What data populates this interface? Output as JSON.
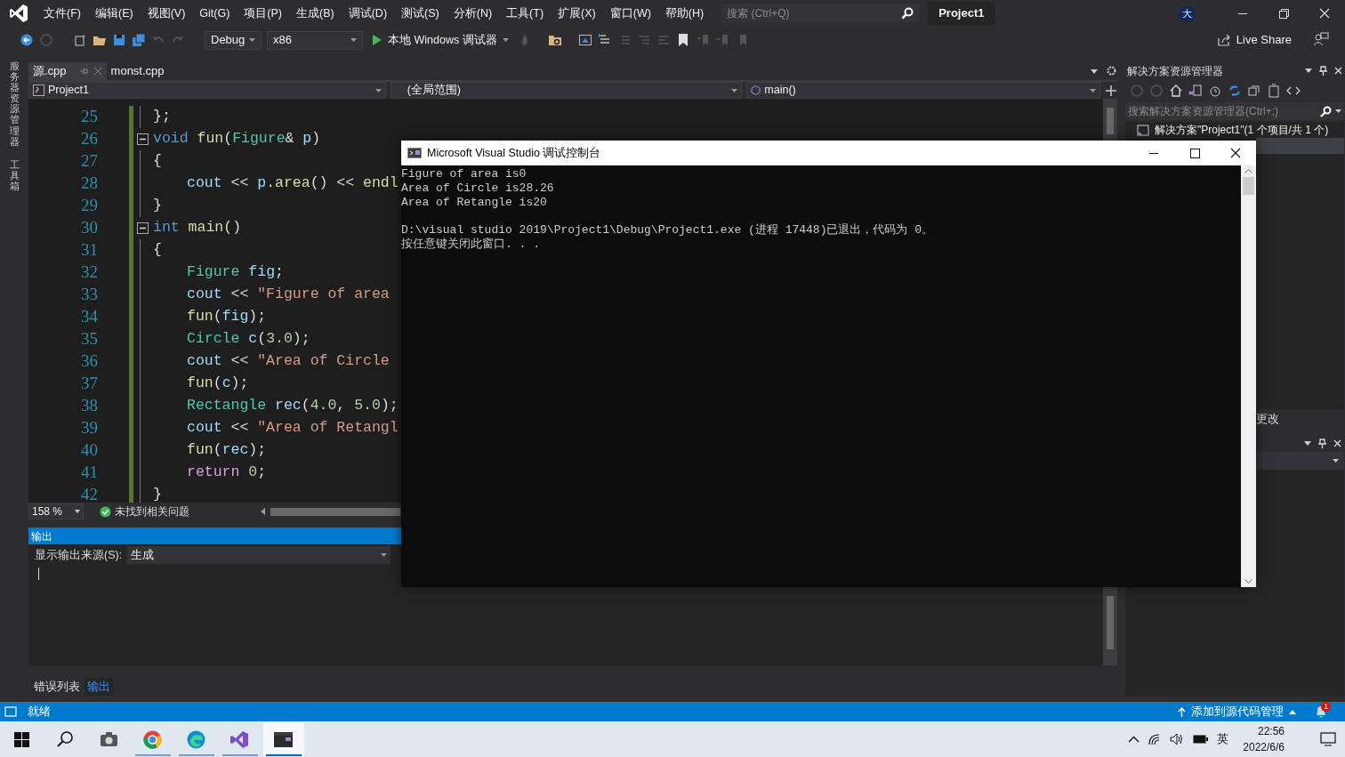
{
  "title_bar": {
    "menus": [
      "文件(F)",
      "编辑(E)",
      "视图(V)",
      "Git(G)",
      "项目(P)",
      "生成(B)",
      "调试(D)",
      "测试(S)",
      "分析(N)",
      "工具(T)",
      "扩展(X)",
      "窗口(W)",
      "帮助(H)"
    ],
    "search": {
      "placeholder": "搜索 (Ctrl+Q)"
    },
    "solution_name": "Project1",
    "account_initial": "大"
  },
  "toolbar": {
    "configuration": "Debug",
    "platform": "x86",
    "run_label": "本地 Windows 调试器",
    "live_share": "Live Share"
  },
  "side_tabs": [
    "服务器资源管理器",
    "工具箱"
  ],
  "document_tabs": [
    {
      "label": "源.cpp",
      "selected": true
    },
    {
      "label": "monst.cpp",
      "selected": false
    }
  ],
  "nav_bar": {
    "project": "Project1",
    "scope": "(全局范围)",
    "member": "main()"
  },
  "editor": {
    "lines": [
      {
        "number": "25",
        "foldable": false,
        "indented": false,
        "tokens": [
          {
            "kind": "plain",
            "text": "};"
          }
        ]
      },
      {
        "number": "26",
        "foldable": true,
        "indented": false,
        "tokens": [
          {
            "kind": "keyword",
            "text": "void"
          },
          {
            "kind": "func",
            "text": " fun"
          },
          {
            "kind": "plain",
            "text": "("
          },
          {
            "kind": "type",
            "text": "Figure"
          },
          {
            "kind": "plain",
            "text": "& "
          },
          {
            "kind": "param",
            "text": "p"
          },
          {
            "kind": "plain",
            "text": ")"
          }
        ]
      },
      {
        "number": "27",
        "foldable": false,
        "indented": false,
        "tokens": [
          {
            "kind": "plain",
            "text": "{"
          }
        ]
      },
      {
        "number": "28",
        "foldable": false,
        "indented": true,
        "tokens": [
          {
            "kind": "var",
            "text": "cout"
          },
          {
            "kind": "plain",
            "text": " << "
          },
          {
            "kind": "param",
            "text": "p"
          },
          {
            "kind": "plain",
            "text": "."
          },
          {
            "kind": "func",
            "text": "area"
          },
          {
            "kind": "plain",
            "text": "() << "
          },
          {
            "kind": "func",
            "text": "endl"
          }
        ]
      },
      {
        "number": "29",
        "foldable": false,
        "indented": false,
        "tokens": [
          {
            "kind": "plain",
            "text": "}"
          }
        ]
      },
      {
        "number": "30",
        "foldable": true,
        "indented": false,
        "tokens": [
          {
            "kind": "keyword",
            "text": "int"
          },
          {
            "kind": "func",
            "text": " main"
          },
          {
            "kind": "plain",
            "text": "()"
          }
        ]
      },
      {
        "number": "31",
        "foldable": false,
        "indented": false,
        "tokens": [
          {
            "kind": "plain",
            "text": "{"
          }
        ]
      },
      {
        "number": "32",
        "foldable": false,
        "indented": true,
        "tokens": [
          {
            "kind": "type",
            "text": "Figure"
          },
          {
            "kind": "var",
            "text": " fig"
          },
          {
            "kind": "plain",
            "text": ";"
          }
        ]
      },
      {
        "number": "33",
        "foldable": false,
        "indented": true,
        "tokens": [
          {
            "kind": "var",
            "text": "cout"
          },
          {
            "kind": "plain",
            "text": " << "
          },
          {
            "kind": "string",
            "text": "\"Figure of area"
          }
        ]
      },
      {
        "number": "34",
        "foldable": false,
        "indented": true,
        "tokens": [
          {
            "kind": "func",
            "text": "fun"
          },
          {
            "kind": "plain",
            "text": "("
          },
          {
            "kind": "var",
            "text": "fig"
          },
          {
            "kind": "plain",
            "text": ");"
          }
        ]
      },
      {
        "number": "35",
        "foldable": false,
        "indented": true,
        "tokens": [
          {
            "kind": "type",
            "text": "Circle"
          },
          {
            "kind": "var",
            "text": " c"
          },
          {
            "kind": "plain",
            "text": "("
          },
          {
            "kind": "number",
            "text": "3.0"
          },
          {
            "kind": "plain",
            "text": ");"
          }
        ]
      },
      {
        "number": "36",
        "foldable": false,
        "indented": true,
        "tokens": [
          {
            "kind": "var",
            "text": "cout"
          },
          {
            "kind": "plain",
            "text": " << "
          },
          {
            "kind": "string",
            "text": "\"Area of Circle"
          }
        ]
      },
      {
        "number": "37",
        "foldable": false,
        "indented": true,
        "tokens": [
          {
            "kind": "func",
            "text": "fun"
          },
          {
            "kind": "plain",
            "text": "("
          },
          {
            "kind": "var",
            "text": "c"
          },
          {
            "kind": "plain",
            "text": ");"
          }
        ]
      },
      {
        "number": "38",
        "foldable": false,
        "indented": true,
        "tokens": [
          {
            "kind": "type",
            "text": "Rectangle"
          },
          {
            "kind": "var",
            "text": " rec"
          },
          {
            "kind": "plain",
            "text": "("
          },
          {
            "kind": "number",
            "text": "4.0"
          },
          {
            "kind": "plain",
            "text": ", "
          },
          {
            "kind": "number",
            "text": "5.0"
          },
          {
            "kind": "plain",
            "text": ");"
          }
        ]
      },
      {
        "number": "39",
        "foldable": false,
        "indented": true,
        "tokens": [
          {
            "kind": "var",
            "text": "cout"
          },
          {
            "kind": "plain",
            "text": " << "
          },
          {
            "kind": "string",
            "text": "\"Area of Retangl"
          }
        ]
      },
      {
        "number": "40",
        "foldable": false,
        "indented": true,
        "tokens": [
          {
            "kind": "func",
            "text": "fun"
          },
          {
            "kind": "plain",
            "text": "("
          },
          {
            "kind": "var",
            "text": "rec"
          },
          {
            "kind": "plain",
            "text": ");"
          }
        ]
      },
      {
        "number": "41",
        "foldable": false,
        "indented": true,
        "tokens": [
          {
            "kind": "control",
            "text": "return"
          },
          {
            "kind": "number",
            "text": " 0"
          },
          {
            "kind": "plain",
            "text": ";"
          }
        ]
      },
      {
        "number": "42",
        "foldable": false,
        "indented": false,
        "tokens": [
          {
            "kind": "plain",
            "text": "}"
          }
        ]
      }
    ],
    "zoom": "158 %",
    "issues": "未找到相关问题"
  },
  "output_panel": {
    "title": "输出",
    "source_label": "显示输出来源(S):",
    "source_value": "生成"
  },
  "bottom_tabs": [
    {
      "label": "错误列表",
      "selected": false
    },
    {
      "label": "输出",
      "selected": true
    }
  ],
  "solution_explorer": {
    "title": "解决方案资源管理器",
    "search": {
      "placeholder": "搜索解决方案资源管理器(Ctrl+;)"
    },
    "root": "解决方案\"Project1\"(1 个项目/共 1 个)",
    "partial_tab": "更改"
  },
  "console": {
    "title": "Microsoft Visual Studio 调试控制台",
    "blocks": [
      [
        "Figure of area is0",
        "Area of Circle is28.26",
        "Area of Retangle is20"
      ],
      [
        "D:\\visual studio 2019\\Project1\\Debug\\Project1.exe (进程 17448)已退出，代码为 0。",
        "按任意键关闭此窗口. . ."
      ]
    ]
  },
  "status_bar": {
    "state": "就绪",
    "source_control": "添加到源代码管理",
    "notifications": "1"
  },
  "taskbar": {
    "apps": [
      {
        "kind": "start",
        "running": false,
        "selected": false
      },
      {
        "kind": "search",
        "running": false,
        "selected": false
      },
      {
        "kind": "camera",
        "running": false,
        "selected": false
      },
      {
        "kind": "browser",
        "running": true,
        "selected": false
      },
      {
        "kind": "edge",
        "running": true,
        "selected": false
      },
      {
        "kind": "studio",
        "running": true,
        "selected": false
      },
      {
        "kind": "console",
        "running": true,
        "selected": true
      }
    ],
    "ime": "英",
    "time": "22:56",
    "date": "2022/6/6"
  }
}
